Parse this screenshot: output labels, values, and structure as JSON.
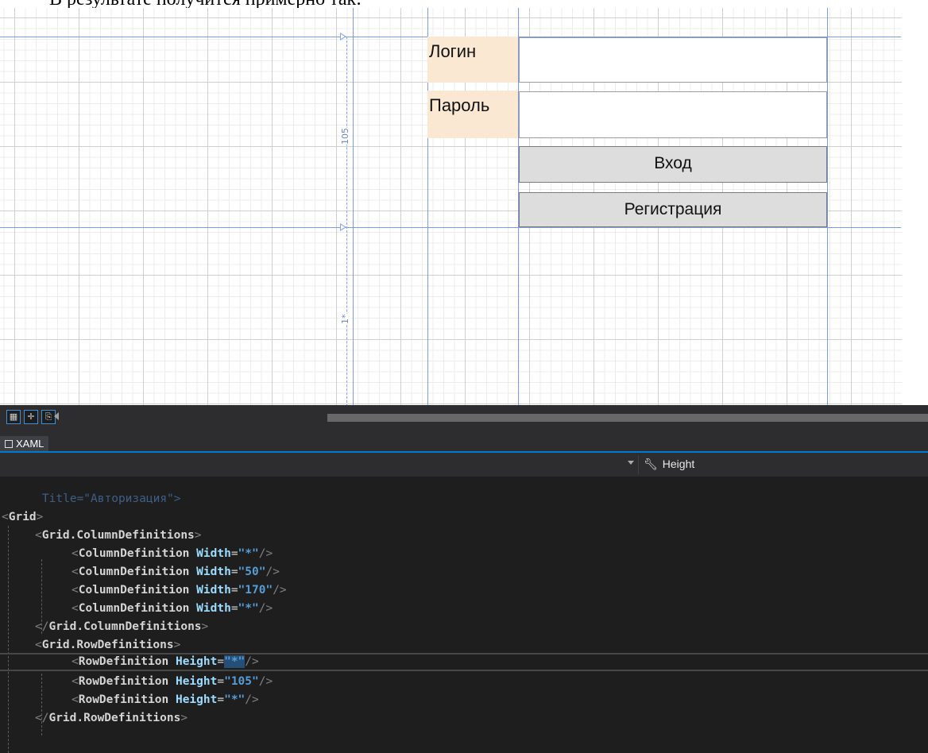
{
  "caption": "В результате получится примерно так:",
  "designer": {
    "label_login": "Логин",
    "label_password": "Пароль",
    "btn_login": "Вход",
    "btn_register": "Регистрация",
    "ruler_row_height": "105",
    "ruler_star": "1*"
  },
  "toolbar": {
    "tab_xaml": "XAML",
    "property": "Height"
  },
  "code": {
    "ghost_line": "Title=\"Авторизация\">",
    "grid_open": "Grid",
    "coldefs_tag": "Grid.ColumnDefinitions",
    "rowdefs_tag": "Grid.RowDefinitions",
    "coldef_tag": "ColumnDefinition",
    "rowdef_tag": "RowDefinition",
    "width_attr": "Width",
    "height_attr": "Height",
    "columns": [
      "\"*\"",
      "\"50\"",
      "\"170\"",
      "\"*\""
    ],
    "rows": [
      "\"*\"",
      "\"105\"",
      "\"*\""
    ]
  },
  "colors": {
    "gridline": "#7c9be0",
    "label_bg": "#fbe8d3",
    "editor_bg": "#1e1e1e",
    "accent": "#007acc"
  }
}
